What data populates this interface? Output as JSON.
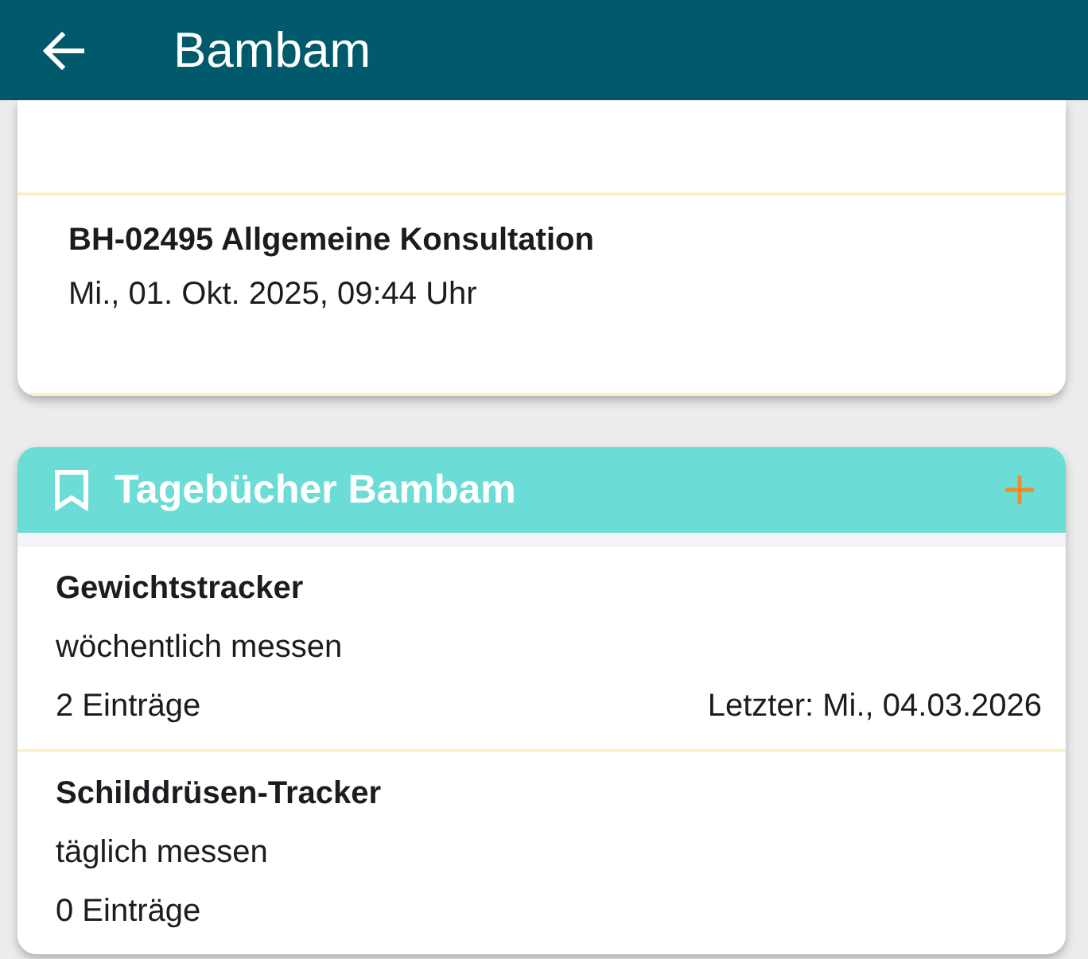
{
  "app_bar": {
    "title": "Bambam"
  },
  "visits": [
    {
      "title": "BH-02495 Allgemeine Konsultation",
      "date": "Mi., 01. Okt. 2025, 09:44 Uhr"
    }
  ],
  "diaries": {
    "title": "Tagebücher Bambam",
    "items": [
      {
        "name": "Gewichtstracker",
        "frequency": "wöchentlich messen",
        "entries": "2 Einträge",
        "last": "Letzter: Mi., 04.03.2026"
      },
      {
        "name": "Schilddrüsen-Tracker",
        "frequency": "täglich messen",
        "entries": "0 Einträge"
      }
    ]
  }
}
